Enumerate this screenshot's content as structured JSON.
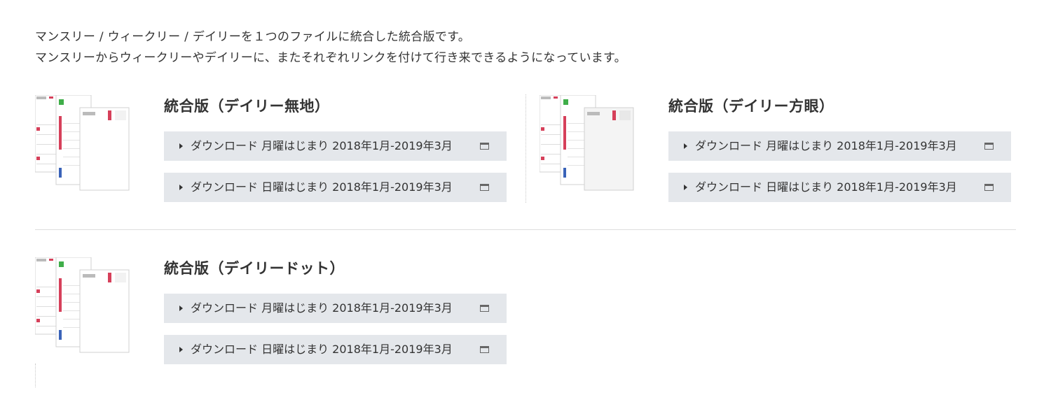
{
  "intro": {
    "line1": "マンスリー / ウィークリー / デイリーを１つのファイルに統合した統合版です。",
    "line2": "マンスリーからウィークリーやデイリーに、またそれぞれリンクを付けて行き来できるようになっています。"
  },
  "items": [
    {
      "title": "統合版（デイリー無地）",
      "buttons": [
        {
          "label": "ダウンロード 月曜はじまり 2018年1月-2019年3月"
        },
        {
          "label": "ダウンロード 日曜はじまり 2018年1月-2019年3月"
        }
      ]
    },
    {
      "title": "統合版（デイリー方眼）",
      "buttons": [
        {
          "label": "ダウンロード 月曜はじまり 2018年1月-2019年3月"
        },
        {
          "label": "ダウンロード 日曜はじまり 2018年1月-2019年3月"
        }
      ]
    },
    {
      "title": "統合版（デイリードット）",
      "buttons": [
        {
          "label": "ダウンロード 月曜はじまり 2018年1月-2019年3月"
        },
        {
          "label": "ダウンロード 日曜はじまり 2018年1月-2019年3月"
        }
      ]
    }
  ],
  "thumbnail": {
    "day_number": "1",
    "accent_red": "#d6405a",
    "accent_green": "#3fae49",
    "accent_blue": "#3a63b8"
  },
  "icons": {
    "arrow": "caret-right-icon",
    "external": "external-window-icon"
  }
}
